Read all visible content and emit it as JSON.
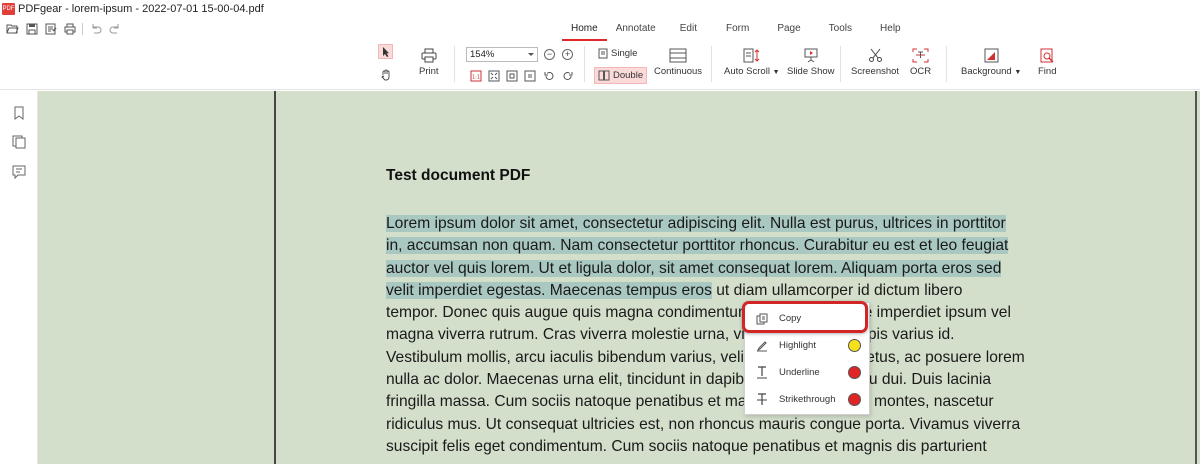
{
  "window": {
    "title": "PDFgear - lorem-ipsum - 2022-07-01 15-00-04.pdf",
    "logo_text": "PDF"
  },
  "quickbar": {
    "items": [
      "open-icon",
      "save-icon",
      "save-as-icon",
      "print-icon",
      "undo-icon",
      "redo-icon"
    ]
  },
  "menu": {
    "tabs": [
      {
        "label": "Home",
        "active": true
      },
      {
        "label": "Annotate",
        "active": false
      },
      {
        "label": "Edit",
        "active": false
      },
      {
        "label": "Form",
        "active": false
      },
      {
        "label": "Page",
        "active": false
      },
      {
        "label": "Tools",
        "active": false
      },
      {
        "label": "Help",
        "active": false
      }
    ]
  },
  "ribbon": {
    "print_label": "Print",
    "zoom_value": "154%",
    "single_label": "Single",
    "double_label": "Double",
    "continuous_label": "Continuous",
    "auto_scroll_label": "Auto Scroll",
    "slide_show_label": "Slide Show",
    "screenshot_label": "Screenshot",
    "ocr_label": "OCR",
    "background_label": "Background",
    "find_label": "Find",
    "accent_color": "#e02828"
  },
  "document": {
    "title": "Test document PDF",
    "highlighted_lines": [
      "Lorem ipsum dolor sit amet, consectetur adipiscing elit. Nulla est purus, ultrices in porttitor",
      "in, accumsan non quam. Nam consectetur porttitor rhoncus. Curabitur eu est et leo feugiat",
      "auctor vel quis lorem. Ut et ligula dolor, sit amet consequat lorem. Aliquam porta eros sed",
      "velit imperdiet egestas. Maecenas tempus eros"
    ],
    "line4_rest": " ut diam ullamcorper id dictum libero",
    "lines": [
      "tempor. Donec quis augue quis magna condimentum lobortis. Quisque imperdiet ipsum vel",
      "magna viverra rutrum. Cras viverra molestie urna, vitae vestibulum turpis varius id.",
      "Vestibulum mollis, arcu iaculis bibendum varius, velit sapien blandit metus, ac posuere lorem",
      "nulla ac dolor. Maecenas urna elit, tincidunt in dapibus nec, vehicula eu dui. Duis lacinia",
      "fringilla massa. Cum sociis natoque penatibus et magnis dis parturient montes, nascetur",
      "ridiculus mus. Ut consequat ultricies est, non rhoncus mauris congue porta. Vivamus viverra",
      "suscipit felis eget condimentum. Cum sociis natoque penatibus et magnis dis parturient"
    ],
    "highlight_color": "#aac8c2",
    "page_background": "#d3decb"
  },
  "context_menu": {
    "copy": "Copy",
    "highlight": "Highlight",
    "underline": "Underline",
    "strikethrough": "Strikethrough",
    "highlight_color": "#f5e11c",
    "underline_color": "#e02525",
    "strikethrough_color": "#e02525"
  }
}
